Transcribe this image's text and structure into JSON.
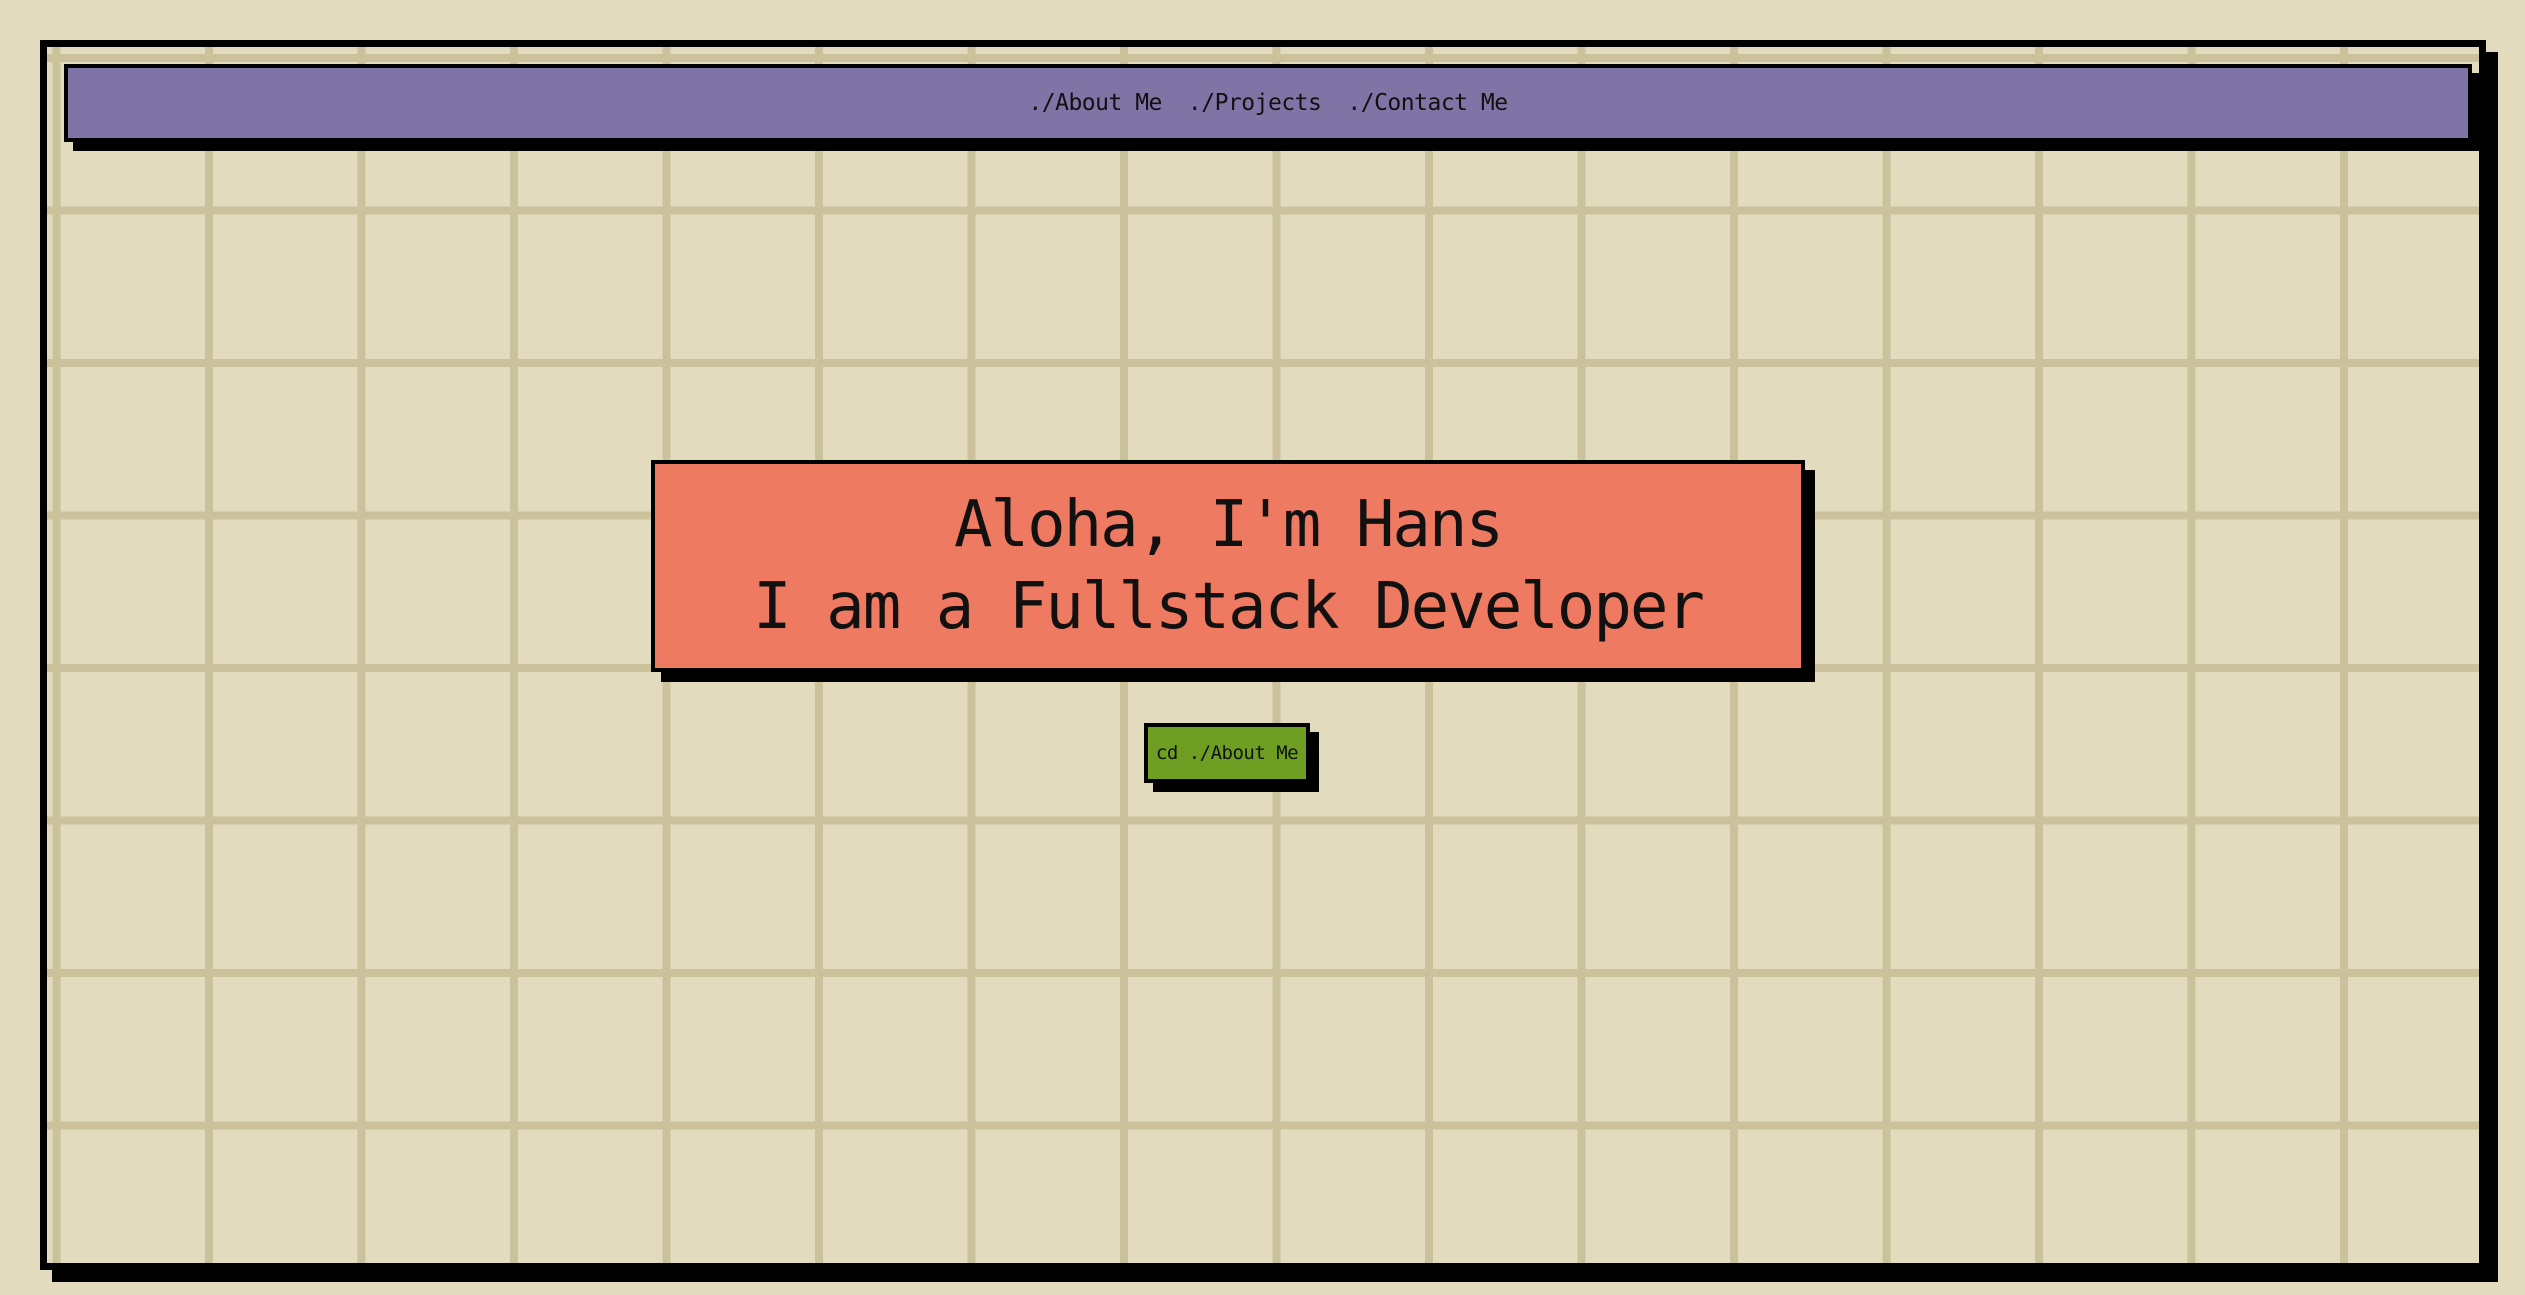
{
  "nav": {
    "links": [
      {
        "label": "./About Me"
      },
      {
        "label": "./Projects"
      },
      {
        "label": "./Contact Me"
      }
    ]
  },
  "hero": {
    "greeting": "Aloha, I'm Hans",
    "tagline": "I am a Fullstack Developer",
    "cta_label": "cd ./About Me"
  },
  "colors": {
    "page_background": "#e2dbbe",
    "grid_lines": "#cbc19b",
    "navbar": "#8073a6",
    "hero_card": "#ed7a61",
    "cta_button": "#6e9f22",
    "border_shadow": "#000000"
  }
}
